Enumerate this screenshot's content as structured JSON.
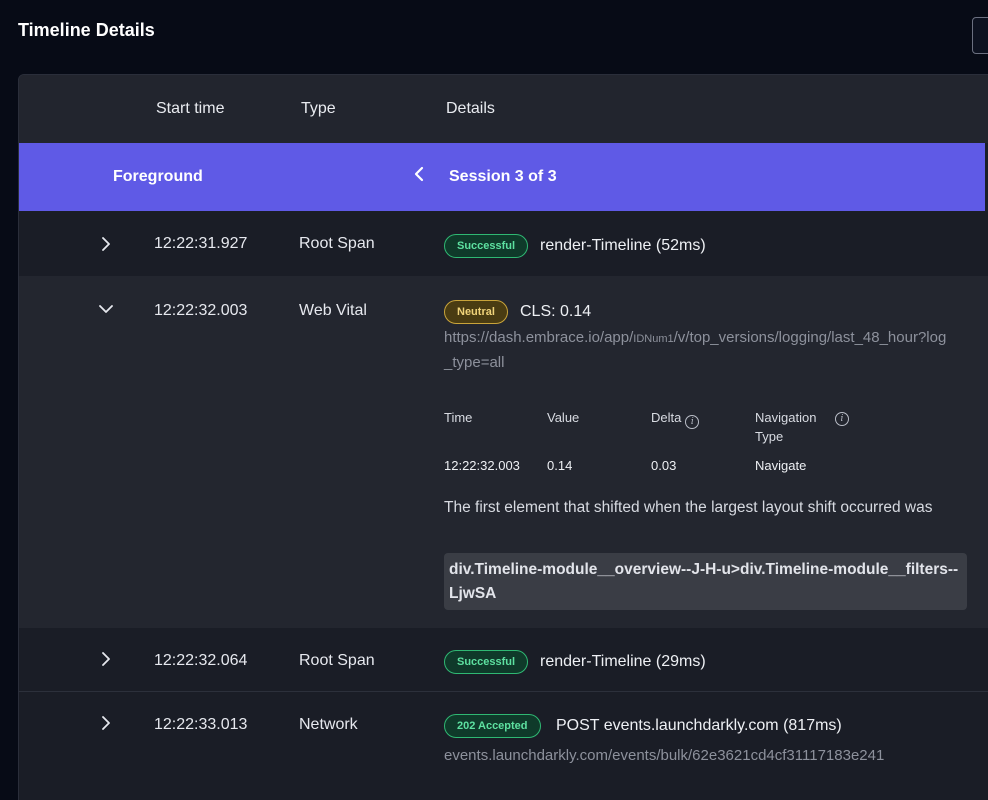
{
  "page": {
    "title": "Timeline Details"
  },
  "table": {
    "headers": {
      "start_time": "Start time",
      "type": "Type",
      "details": "Details"
    }
  },
  "session_bar": {
    "label": "Foreground",
    "prev_icon": "chevron-left-icon",
    "session_text": "Session 3 of 3"
  },
  "rows": [
    {
      "expanded": false,
      "start_time": "12:22:31.927",
      "type": "Root Span",
      "badge": "Successful",
      "summary": "render-Timeline (52ms)"
    },
    {
      "expanded": true,
      "start_time": "12:22:32.003",
      "type": "Web Vital",
      "badge": "Neutral",
      "summary": "CLS: 0.14",
      "url_prefix": "https://dash.embrace.io/app/",
      "url_small": "IDNum1",
      "url_suffix": "/v/top_versions/logging/last_48_hour?log_type=all",
      "vital_table": {
        "headers": {
          "time": "Time",
          "value": "Value",
          "delta": "Delta",
          "navigation_type": "Navigation Type"
        },
        "values": {
          "time": "12:22:32.003",
          "value": "0.14",
          "delta": "0.03",
          "navigation_type": "Navigate"
        }
      },
      "description": "The first element that shifted when the largest layout shift occurred was",
      "selector": "div.Timeline-module__overview--J-H-u>div.Timeline-module__filters--LjwSA"
    },
    {
      "expanded": false,
      "start_time": "12:22:32.064",
      "type": "Root Span",
      "badge": "Successful",
      "summary": "render-Timeline (29ms)"
    },
    {
      "expanded": false,
      "start_time": "12:22:33.013",
      "type": "Network",
      "badge": "202 Accepted",
      "summary": "POST events.launchdarkly.com (817ms)",
      "url": "events.launchdarkly.com/events/bulk/62e3621cd4cf31117183e241"
    }
  ],
  "colors": {
    "background": "#070b16",
    "panel": "#1b1e27",
    "session_bar": "#5f5ae6",
    "success": "#2fb873",
    "neutral": "#c9a43a"
  }
}
